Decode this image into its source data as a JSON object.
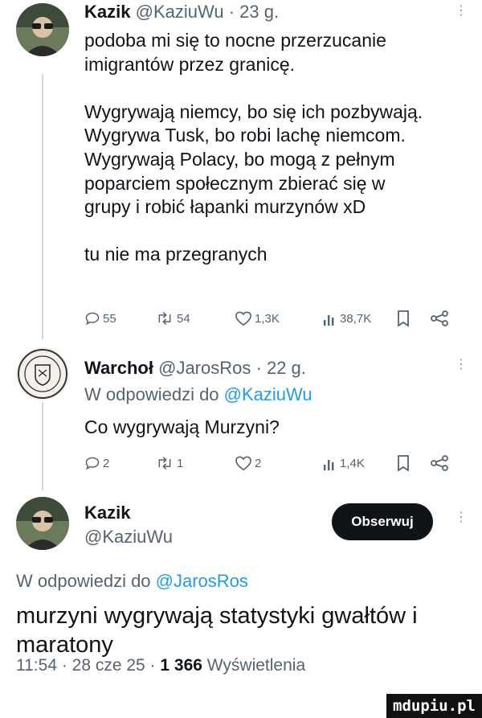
{
  "tweet1": {
    "name": "Kazik",
    "handle": "@KaziuWu",
    "dot": "·",
    "time": "23 g.",
    "text": "podoba mi się to nocne przerzucanie\nimigrantów przez granicę.\n\nWygrywają niemcy, bo się ich pozbywają.\nWygrywa Tusk, bo robi lachę niemcom.\nWygrywają Polacy, bo mogą z pełnym\npoparciem społecznym zbierać się w\ngrupy i robić łapanki murzynów xD\n\ntu nie ma przegranych",
    "replies": "55",
    "retweets": "54",
    "likes": "1,3K",
    "views": "38,7K"
  },
  "tweet2": {
    "name": "Warchoł",
    "handle": "@JarosRos",
    "dot": "·",
    "time": "22 g.",
    "reply_prefix": "W odpowiedzi do ",
    "reply_handle": "@KaziuWu",
    "text": "Co wygrywają Murzyni?",
    "replies": "2",
    "retweets": "1",
    "likes": "2",
    "views": "1,4K"
  },
  "main": {
    "name": "Kazik",
    "handle": "@KaziuWu",
    "follow_label": "Obserwuj",
    "reply_prefix": "W odpowiedzi do ",
    "reply_handle": "@JarosRos",
    "text": "murzyni wygrywają statystyki gwałtów i maratony",
    "time": "11:54 · 28 cze 25 · ",
    "views_count": "1 366",
    "views_label": " Wyświetlenia"
  },
  "watermark": "mdupiu.pl",
  "colors": {
    "text": "#0f1419",
    "secondary": "#536471",
    "link": "#1d9bf0",
    "thread_line": "#cfd9de",
    "button_bg": "#0f1419"
  },
  "icons": [
    "reply-icon",
    "retweet-icon",
    "like-icon",
    "views-icon",
    "bookmark-icon",
    "share-icon",
    "more-icon"
  ]
}
